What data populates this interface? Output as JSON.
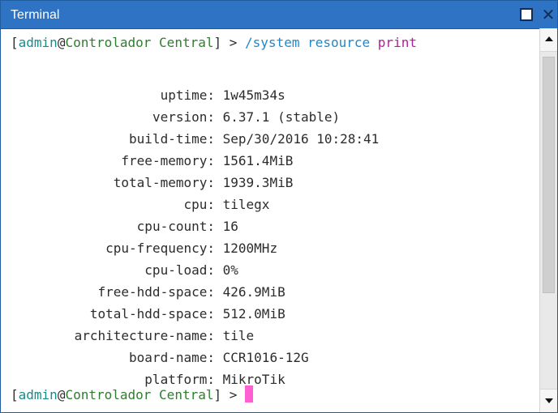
{
  "window": {
    "title": "Terminal"
  },
  "prompt": {
    "open": "[",
    "user": "admin",
    "at": "@",
    "host": "Controlador Central",
    "close": "]",
    "arrow": " > "
  },
  "command": {
    "path": "/system resource ",
    "action": "print"
  },
  "resources": [
    {
      "key": "uptime:",
      "value": "1w45m34s"
    },
    {
      "key": "version:",
      "value": "6.37.1 (stable)"
    },
    {
      "key": "build-time:",
      "value": "Sep/30/2016 10:28:41"
    },
    {
      "key": "free-memory:",
      "value": "1561.4MiB"
    },
    {
      "key": "total-memory:",
      "value": "1939.3MiB"
    },
    {
      "key": "cpu:",
      "value": "tilegx"
    },
    {
      "key": "cpu-count:",
      "value": "16"
    },
    {
      "key": "cpu-frequency:",
      "value": "1200MHz"
    },
    {
      "key": "cpu-load:",
      "value": "0%"
    },
    {
      "key": "free-hdd-space:",
      "value": "426.9MiB"
    },
    {
      "key": "total-hdd-space:",
      "value": "512.0MiB"
    },
    {
      "key": "architecture-name:",
      "value": "tile"
    },
    {
      "key": "board-name:",
      "value": "CCR1016-12G"
    },
    {
      "key": "platform:",
      "value": "MikroTik"
    }
  ],
  "colors": {
    "titlebar": "#2f74c4",
    "prompt_user": "#1b8a8a",
    "prompt_host": "#2f7d2f",
    "command": "#1f88c9",
    "command_action": "#b0209a",
    "cursor": "#ff5fd0"
  },
  "icons": {
    "maximize": "maximize-icon",
    "close": "close-icon",
    "scroll_up": "arrow-up-icon",
    "scroll_down": "arrow-down-icon"
  },
  "close_glyph": "✕"
}
